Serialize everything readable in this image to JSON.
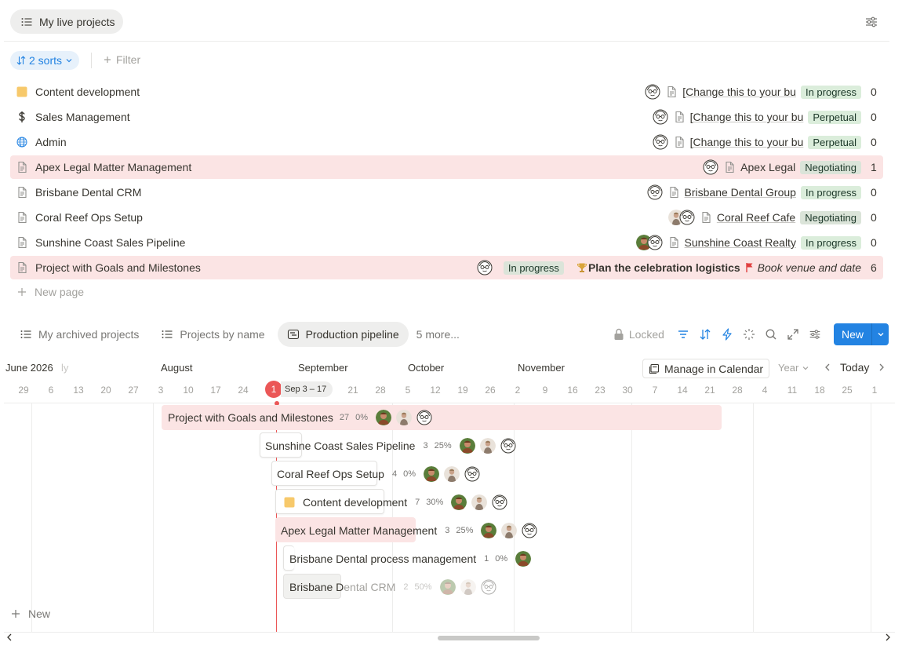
{
  "top_view": {
    "label": "My live projects",
    "icon": "list-icon"
  },
  "controls": {
    "sorts_label": "2 sorts",
    "filter_label": "Filter"
  },
  "projects": [
    {
      "title": "Content development",
      "icon": "yellow-square-icon",
      "highlighted": false,
      "ref": "[Change this to your bu",
      "status": "In progress",
      "count": "0"
    },
    {
      "title": "Sales Management",
      "icon": "dollar-icon",
      "highlighted": false,
      "ref": "[Change this to your bu",
      "status": "Perpetual",
      "count": "0"
    },
    {
      "title": "Admin",
      "icon": "globe-icon",
      "highlighted": false,
      "ref": "[Change this to your bu",
      "status": "Perpetual",
      "count": "0"
    },
    {
      "title": "Apex Legal Matter Management",
      "icon": "page-icon",
      "highlighted": true,
      "ref": "Apex Legal",
      "status": "Negotiating",
      "count": "1"
    },
    {
      "title": "Brisbane Dental CRM",
      "icon": "page-icon",
      "highlighted": false,
      "ref": "Brisbane Dental Group",
      "status": "In progress",
      "count": "0"
    },
    {
      "title": "Coral Reef Ops Setup",
      "icon": "page-icon",
      "highlighted": false,
      "ref": "Coral Reef Cafe",
      "status": "Negotiating",
      "count": "0"
    },
    {
      "title": "Sunshine Coast Sales Pipeline",
      "icon": "page-icon",
      "highlighted": false,
      "ref": "Sunshine Coast Realty",
      "status": "In progress",
      "count": "0"
    },
    {
      "title": "Project with Goals and Milestones",
      "icon": "page-icon",
      "highlighted": true,
      "status": "In progress",
      "goal": "Plan the celebration logistics",
      "milestone": "Book venue and date",
      "count": "6"
    }
  ],
  "new_page_label": "New page",
  "view_tabs": [
    {
      "label": "My archived projects",
      "icon": "list-icon"
    },
    {
      "label": "Projects by name",
      "icon": "list-icon"
    },
    {
      "label": "Production pipeline",
      "icon": "timeline-icon",
      "active": true
    }
  ],
  "more_label": "5 more...",
  "toolbar": {
    "locked_label": "Locked",
    "new_label": "New"
  },
  "timeline": {
    "months": [
      "June 2026",
      "ly",
      "August",
      "September",
      "October",
      "November"
    ],
    "days": [
      "29",
      "6",
      "13",
      "20",
      "27",
      "3",
      "10",
      "17",
      "24",
      "21",
      "28",
      "5",
      "12",
      "19",
      "26",
      "2",
      "9",
      "16",
      "23",
      "30",
      "7",
      "14",
      "21",
      "28",
      "4",
      "11",
      "18",
      "25",
      "1"
    ],
    "today_day": "1",
    "current_week": "Sep 3 – 17",
    "manage_label": "Manage in Calendar",
    "scale_label": "Year",
    "today_label": "Today",
    "bars": [
      {
        "title": "Project with Goals and Milestones",
        "count": "27",
        "progress": "0%"
      },
      {
        "title": "Sunshine Coast Sales Pipeline",
        "count": "3",
        "progress": "25%"
      },
      {
        "title": "Coral Reef Ops Setup",
        "count": "4",
        "progress": "0%"
      },
      {
        "title": "Content development",
        "count": "7",
        "progress": "30%"
      },
      {
        "title": "Apex Legal Matter Management",
        "count": "3",
        "progress": "25%"
      },
      {
        "title": "Brisbane Dental process management",
        "count": "1",
        "progress": "0%"
      },
      {
        "title_a": "Brisbane D",
        "title_b": "ental CRM",
        "count": "2",
        "progress": "50%"
      }
    ],
    "new_label": "New"
  },
  "colors": {
    "accent": "#2383e2",
    "today": "#eb5757",
    "highlight": "#fbe4e4",
    "status_bg": "#dbeddb"
  }
}
